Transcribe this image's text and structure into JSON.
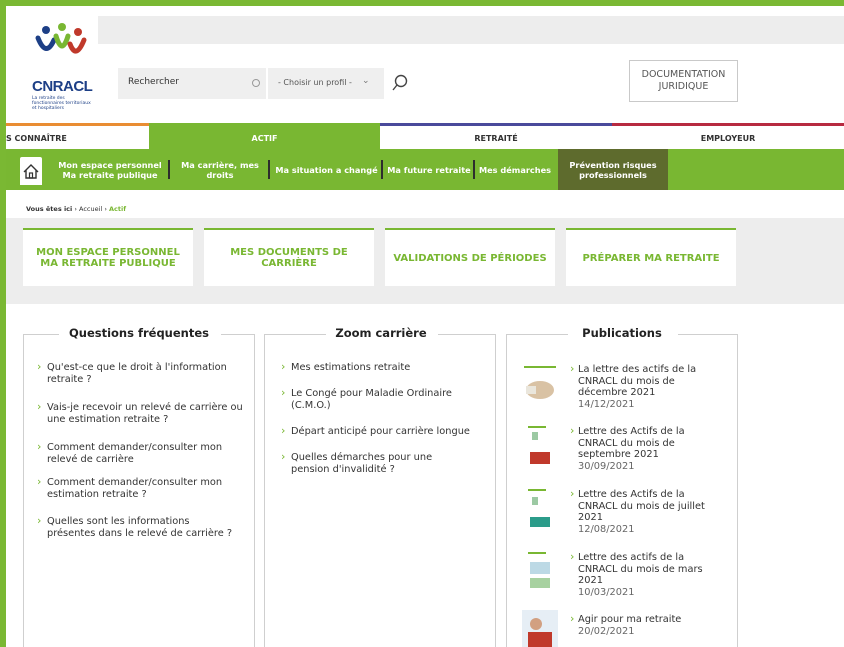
{
  "header": {
    "logo_name": "CNRACL",
    "logo_subtitle": "La retraite des fonctionnaires territoriaux et hospitaliers",
    "search_placeholder": "Rechercher",
    "profile_select": "- Choisir un profil -",
    "doc_button": "DOCUMENTATION JURIDIQUE"
  },
  "main_nav": [
    "S CONNAÎTRE",
    "ACTIF",
    "RETRAITÉ",
    "EMPLOYEUR"
  ],
  "sub_nav": [
    "Mon espace personnel Ma retraite publique",
    "Ma carrière, mes droits",
    "Ma situation a changé",
    "Ma future retraite",
    "Mes démarches",
    "Prévention risques professionnels"
  ],
  "breadcrumb": {
    "label": "Vous êtes ici",
    "home": "Accueil",
    "current": "Actif"
  },
  "cards": [
    "MON ESPACE PERSONNEL MA RETRAITE PUBLIQUE",
    "MES DOCUMENTS DE CARRIÈRE",
    "VALIDATIONS DE PÉRIODES",
    "PRÉPARER MA RETRAITE"
  ],
  "faq": {
    "title": "Questions fréquentes",
    "items": [
      "Qu'est-ce que le droit à l'information retraite ?",
      "Vais-je recevoir un relevé de carrière ou une estimation retraite ?",
      "Comment demander/consulter mon relevé de carrière",
      "Comment demander/consulter mon estimation retraite ?",
      "Quelles sont les informations présentes dans le relevé de carrière ?"
    ]
  },
  "zoom": {
    "title": "Zoom carrière",
    "items": [
      "Mes estimations retraite",
      "Le Congé pour Maladie Ordinaire (C.M.O.)",
      "Départ anticipé pour carrière longue",
      "Quelles démarches pour une pension d'invalidité ?"
    ]
  },
  "publications": {
    "title": "Publications",
    "items": [
      {
        "title": "La lettre des actifs de la CNRACL du mois de décembre 2021",
        "date": "14/12/2021"
      },
      {
        "title": "Lettre des Actifs de la CNRACL du mois de septembre 2021",
        "date": "30/09/2021"
      },
      {
        "title": "Lettre des Actifs de la CNRACL du mois de juillet 2021",
        "date": "12/08/2021"
      },
      {
        "title": "Lettre des actifs de la CNRACL du mois de mars 2021",
        "date": "10/03/2021"
      },
      {
        "title": "Agir pour ma retraite",
        "date": "20/02/2021"
      }
    ]
  },
  "colors": {
    "accent_green": "#79b732",
    "dark_olive": "#5e6b2d",
    "orange": "#e98d33",
    "navy": "#4a4a9b",
    "red": "#b72a40",
    "logo_blue": "#1d3f86"
  }
}
